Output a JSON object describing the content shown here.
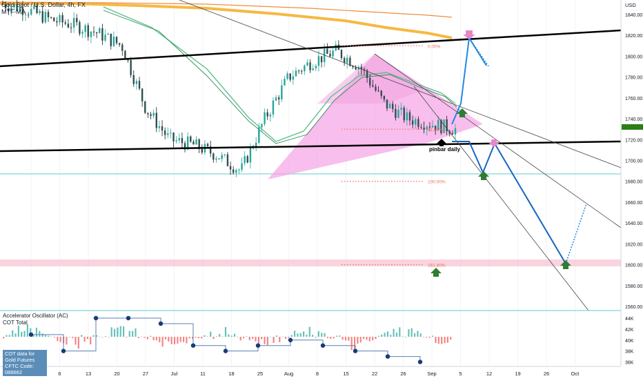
{
  "header": {
    "symbol": "Gold Spot / U.S. Dollar, 4h, FX",
    "indicator": "MTF-MA",
    "currency": "USD"
  },
  "price_axis": {
    "ticks": [
      "1840.00",
      "1820.00",
      "1800.00",
      "1780.00",
      "1760.00",
      "1740.00",
      "1720.00",
      "1700.00",
      "1680.00",
      "1660.00",
      "1640.00",
      "1620.00",
      "1600.00",
      "1580.00",
      "1560.00"
    ],
    "current_price_marker_color": "#2a7f16"
  },
  "time_axis": {
    "ticks": [
      "Jun",
      "6",
      "13",
      "20",
      "27",
      "Jul",
      "11",
      "18",
      "25",
      "Aug",
      "8",
      "15",
      "22",
      "26",
      "Sep",
      "5",
      "12",
      "19",
      "26",
      "Oct"
    ]
  },
  "fib_levels": [
    {
      "label": "0.00%",
      "price": 1810
    },
    {
      "label": "61.80%",
      "price": 1730
    },
    {
      "label": "100.00%",
      "price": 1680
    },
    {
      "label": "161.80%",
      "price": 1600
    }
  ],
  "annotations": {
    "pinbar_label": "pinbar daily"
  },
  "oscillator_panel": {
    "title": "Accelerator Oscillator (AC)",
    "subtitle": "COT Total",
    "cot_box_line1": "COT data for Gold Futures",
    "cot_box_line2": "CFTC Code: 088662",
    "ticks": [
      "44K",
      "42K",
      "40K",
      "38K",
      "36K"
    ]
  },
  "colors": {
    "candle_up": "#26a69a",
    "candle_down": "#ef5350",
    "pink_zone": "#f5a3e6",
    "trendline": "#000000",
    "projection": "#1565c0",
    "ma_orange": "#f5b942",
    "ma_green": "#5cbf8a",
    "fib": "#f26b5b"
  },
  "chart_data": [
    {
      "type": "line",
      "title": "Gold Spot / U.S. Dollar, 4h, FX",
      "x": [
        "Jun",
        "6",
        "13",
        "20",
        "27",
        "Jul",
        "11",
        "18",
        "25",
        "Aug",
        "8",
        "15",
        "22",
        "26",
        "Sep",
        "5",
        "12",
        "19",
        "26",
        "Oct"
      ],
      "series": [
        {
          "name": "price",
          "values": [
            1850,
            1845,
            1835,
            1830,
            1822,
            1810,
            1750,
            1720,
            1715,
            1705,
            1690,
            1740,
            1780,
            1795,
            1805,
            1790,
            1755,
            1740,
            1735,
            1730
          ]
        }
      ],
      "ylim": [
        1555,
        1845
      ],
      "annotations": [
        "pinbar daily",
        "0.00%",
        "61.80%",
        "100.00%",
        "161.80%"
      ]
    },
    {
      "type": "bar",
      "title": "Accelerator Oscillator (AC)",
      "series": [
        {
          "name": "COT Total",
          "values": [
            41,
            38,
            44,
            44,
            43,
            39,
            38,
            39,
            40,
            39,
            38,
            37,
            36
          ]
        }
      ],
      "ylim": [
        35,
        45
      ]
    }
  ]
}
